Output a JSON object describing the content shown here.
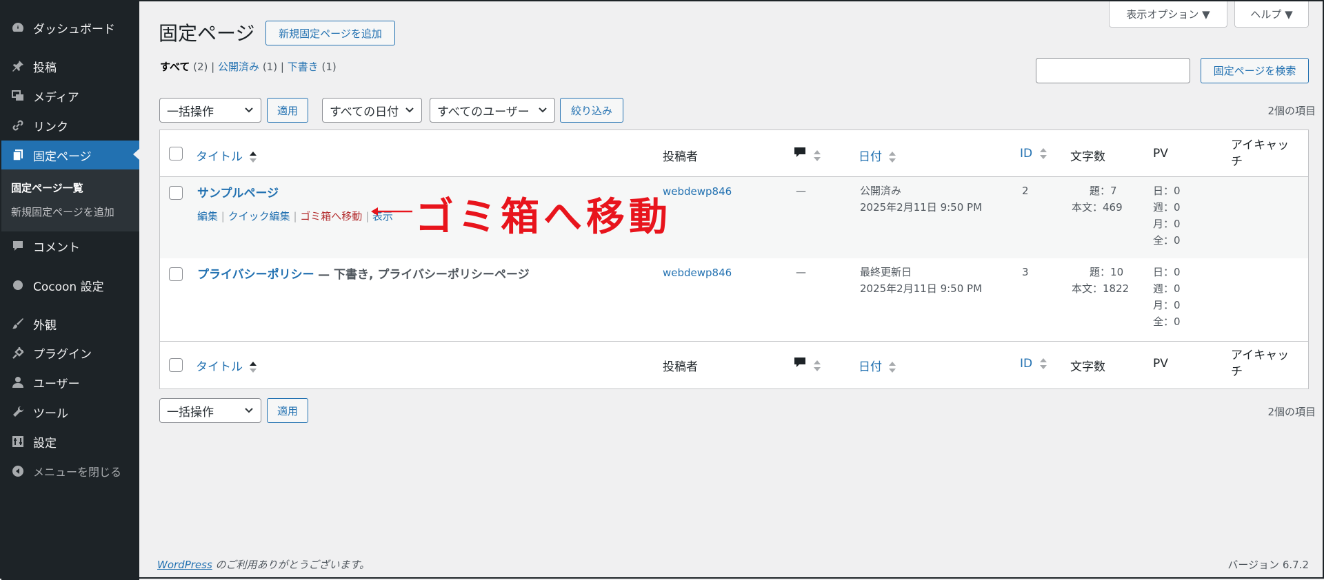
{
  "sidebar": {
    "items": [
      {
        "label": "ダッシュボード",
        "icon": "dashboard-icon"
      },
      {
        "label": "投稿",
        "icon": "pin-icon"
      },
      {
        "label": "メディア",
        "icon": "media-icon"
      },
      {
        "label": "リンク",
        "icon": "link-icon"
      },
      {
        "label": "固定ページ",
        "icon": "pages-icon"
      },
      {
        "label": "コメント",
        "icon": "comment-icon"
      },
      {
        "label": "Cocoon 設定",
        "icon": "circle-icon"
      },
      {
        "label": "外観",
        "icon": "brush-icon"
      },
      {
        "label": "プラグイン",
        "icon": "plugin-icon"
      },
      {
        "label": "ユーザー",
        "icon": "user-icon"
      },
      {
        "label": "ツール",
        "icon": "wrench-icon"
      },
      {
        "label": "設定",
        "icon": "settings-icon"
      }
    ],
    "submenu": [
      "固定ページ一覧",
      "新規固定ページを追加"
    ],
    "collapse_label": "メニューを閉じる"
  },
  "screen_options": "表示オプション",
  "help": "ヘルプ",
  "page_title": "固定ページ",
  "add_new": "新規固定ページを追加",
  "filters": {
    "all": "すべて",
    "all_count": "(2)",
    "published": "公開済み",
    "published_count": "(1)",
    "draft": "下書き",
    "draft_count": "(1)",
    "sep": "|"
  },
  "search_button": "固定ページを検索",
  "bulk_action": "一括操作",
  "apply": "適用",
  "date_filter": "すべての日付",
  "user_filter": "すべてのユーザー",
  "filter_button": "絞り込み",
  "item_count": "2個の項目",
  "columns": {
    "title": "タイトル",
    "author": "投稿者",
    "date": "日付",
    "id": "ID",
    "chars": "文字数",
    "pv": "PV",
    "thumb_1": "アイキャッ",
    "thumb_2": "チ"
  },
  "rows": [
    {
      "title": "サンプルページ",
      "state": "",
      "author": "webdewp846",
      "comments": "—",
      "date_status": "公開済み",
      "date": "2025年2月11日 9:50 PM",
      "id": "2",
      "chars_title": "題：7",
      "chars_body": "本文：469",
      "pv": [
        "日：0",
        "週：0",
        "月：0",
        "全：0"
      ],
      "actions": {
        "edit": "編集",
        "quick_edit": "クイック編集",
        "trash": "ゴミ箱へ移動",
        "view": "表示",
        "sep": "|"
      }
    },
    {
      "title": "プライバシーポリシー",
      "state": "— 下書き, プライバシーポリシーページ",
      "author": "webdewp846",
      "comments": "—",
      "date_status": "最終更新日",
      "date": "2025年2月11日 9:50 PM",
      "id": "3",
      "chars_title": "題：10",
      "chars_body": "本文：1822",
      "pv": [
        "日：0",
        "週：0",
        "月：0",
        "全：0"
      ]
    }
  ],
  "annotation": "ゴミ箱へ移動",
  "footer": {
    "link": "WordPress",
    "text": " のご利用ありがとうございます。",
    "version": "バージョン 6.7.2"
  },
  "colors": {
    "accent": "#2271b1",
    "sidebar": "#1d2327",
    "annotation": "#e8141c",
    "trash": "#b32d2e"
  }
}
